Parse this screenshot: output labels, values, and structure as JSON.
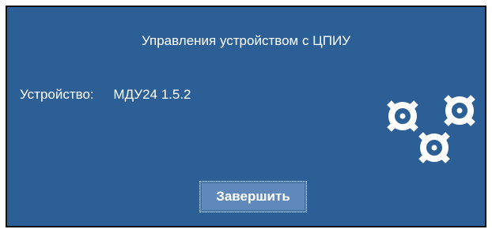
{
  "dialog": {
    "title": "Управления устройством с ЦПИУ",
    "device_label": "Устройство:",
    "device_value": "МДУ24 1.5.2",
    "finish_button_label": "Завершить"
  },
  "icons": {
    "gears": "gears-icon"
  },
  "colors": {
    "background": "#2b5f95",
    "button": "#5e89ba",
    "text": "#ffffff",
    "border": "#111111"
  }
}
